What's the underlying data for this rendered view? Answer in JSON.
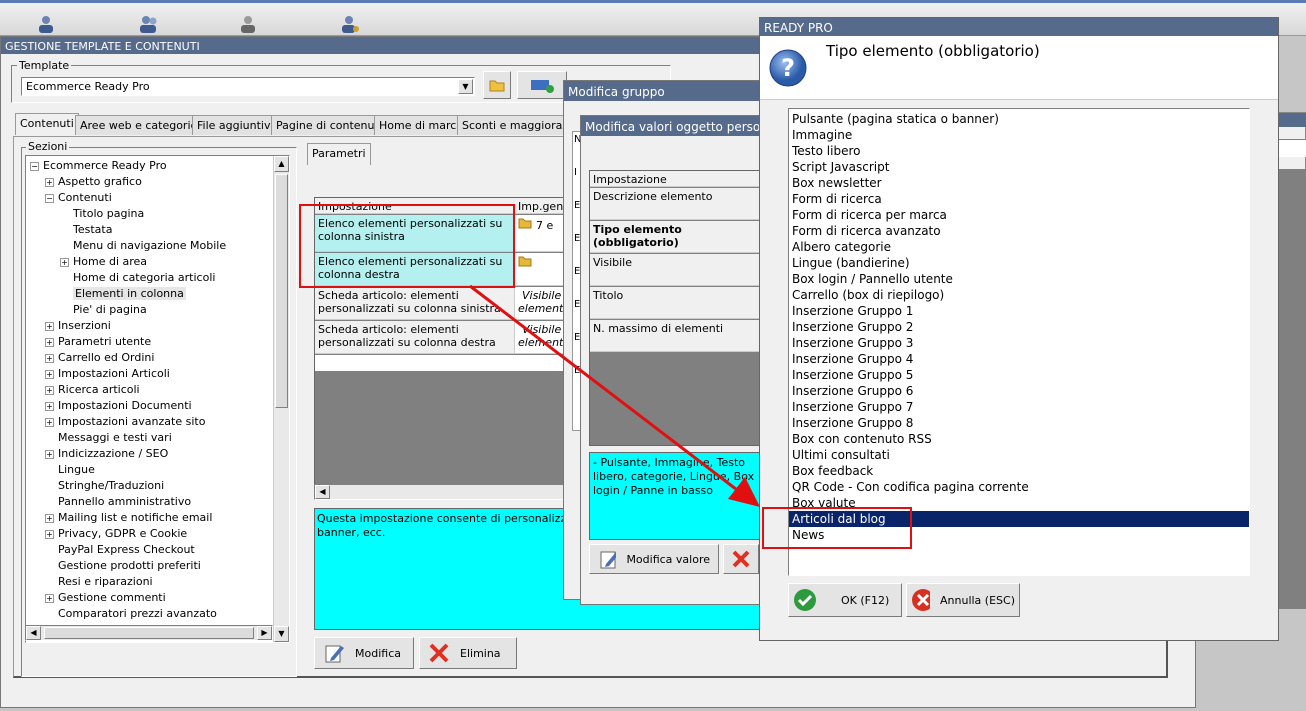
{
  "toolbar_icons": [
    "user-icon",
    "users-icon",
    "user-gray-icon",
    "user-settings-icon"
  ],
  "main": {
    "title": "GESTIONE TEMPLATE E CONTENUTI",
    "template_label": "Template",
    "template_value": "Ecommerce Ready Pro",
    "tabs": [
      "Contenuti",
      "Aree web e categorie",
      "File aggiuntivi",
      "Pagine di contenuti",
      "Home di marca",
      "Sconti e maggiorazio"
    ],
    "sections_label": "Sezioni",
    "tree": [
      {
        "label": "Ecommerce Ready Pro",
        "level": 0,
        "exp": "-"
      },
      {
        "label": "Aspetto grafico",
        "level": 1,
        "exp": "+"
      },
      {
        "label": "Contenuti",
        "level": 1,
        "exp": "-"
      },
      {
        "label": "Titolo pagina",
        "level": 2,
        "exp": ""
      },
      {
        "label": "Testata",
        "level": 2,
        "exp": ""
      },
      {
        "label": "Menu di navigazione Mobile",
        "level": 2,
        "exp": ""
      },
      {
        "label": "Home di area",
        "level": 2,
        "exp": "+"
      },
      {
        "label": "Home di categoria articoli",
        "level": 2,
        "exp": ""
      },
      {
        "label": "Elementi in colonna",
        "level": 2,
        "exp": "",
        "selected": true
      },
      {
        "label": "Pie' di pagina",
        "level": 2,
        "exp": ""
      },
      {
        "label": "Inserzioni",
        "level": 1,
        "exp": "+"
      },
      {
        "label": "Parametri utente",
        "level": 1,
        "exp": "+"
      },
      {
        "label": "Carrello ed Ordini",
        "level": 1,
        "exp": "+"
      },
      {
        "label": "Impostazioni Articoli",
        "level": 1,
        "exp": "+"
      },
      {
        "label": "Ricerca articoli",
        "level": 1,
        "exp": "+"
      },
      {
        "label": "Impostazioni Documenti",
        "level": 1,
        "exp": "+"
      },
      {
        "label": "Impostazioni avanzate sito",
        "level": 1,
        "exp": "+"
      },
      {
        "label": "Messaggi e testi vari",
        "level": 1,
        "exp": ""
      },
      {
        "label": "Indicizzazione / SEO",
        "level": 1,
        "exp": "+"
      },
      {
        "label": "Lingue",
        "level": 1,
        "exp": ""
      },
      {
        "label": "Stringhe/Traduzioni",
        "level": 1,
        "exp": ""
      },
      {
        "label": "Pannello amministrativo",
        "level": 1,
        "exp": ""
      },
      {
        "label": "Mailing list e notifiche email",
        "level": 1,
        "exp": "+"
      },
      {
        "label": "Privacy, GDPR e Cookie",
        "level": 1,
        "exp": "+"
      },
      {
        "label": "PayPal Express Checkout",
        "level": 1,
        "exp": ""
      },
      {
        "label": "Gestione prodotti preferiti",
        "level": 1,
        "exp": ""
      },
      {
        "label": "Resi e riparazioni",
        "level": 1,
        "exp": ""
      },
      {
        "label": "Gestione commenti",
        "level": 1,
        "exp": "+"
      },
      {
        "label": "Comparatori prezzi avanzato",
        "level": 1,
        "exp": ""
      }
    ],
    "params_tab": "Parametri",
    "grid_header": [
      "Impostazione",
      "Imp.gene"
    ],
    "grid_rows": [
      {
        "name": "Elenco elementi personalizzati su colonna sinistra",
        "value": "7 e"
      },
      {
        "name": "Elenco elementi personalizzati su colonna destra",
        "value": ""
      },
      {
        "name": "Scheda articolo: elementi personalizzati su colonna sinistra",
        "value": "Visibile co elementi d"
      },
      {
        "name": "Scheda articolo: elementi personalizzati su colonna destra",
        "value": "Visibile co elementi d"
      }
    ],
    "description": "Questa impostazione consente di personalizzare gli e pagine di contenuti, loghi, banner, ecc.",
    "modify_label": "Modifica",
    "delete_label": "Elimina"
  },
  "group": {
    "title": "Modifica gruppo",
    "inner_title": "Modifica valori oggetto perso",
    "header": "Impostazione",
    "rows": [
      "Descrizione elemento",
      "Tipo elemento (obbligatorio)",
      "Visibile",
      "Titolo",
      "N. massimo di elementi"
    ],
    "letters": [
      "N",
      "I",
      "E",
      "E",
      "E",
      "E",
      "E",
      "E"
    ],
    "description": "- Pulsante, Immagine, Testo libero, categorie, Lingue, Box login / Panne in basso",
    "modify_value": "Modifica valore"
  },
  "ready": {
    "title": "READY PRO",
    "heading": "Tipo elemento (obbligatorio)",
    "items": [
      "Pulsante (pagina statica o banner)",
      "Immagine",
      "Testo libero",
      "Script Javascript",
      "Box newsletter",
      "Form di ricerca",
      "Form di ricerca per marca",
      "Form di ricerca avanzato",
      "Albero categorie",
      "Lingue (bandierine)",
      "Box login / Pannello utente",
      "Carrello (box di riepilogo)",
      "Inserzione Gruppo 1",
      "Inserzione Gruppo 2",
      "Inserzione Gruppo 3",
      "Inserzione Gruppo 4",
      "Inserzione Gruppo 5",
      "Inserzione Gruppo 6",
      "Inserzione Gruppo 7",
      "Inserzione Gruppo 8",
      "Box con contenuto RSS",
      "Ultimi consultati",
      "Box feedback",
      "QR Code - Con codifica pagina corrente",
      "Box valute",
      "Articoli dal blog",
      "News"
    ],
    "selected_index": 25,
    "ok_label": "OK (F12)",
    "cancel_label": "Annulla (ESC)"
  }
}
